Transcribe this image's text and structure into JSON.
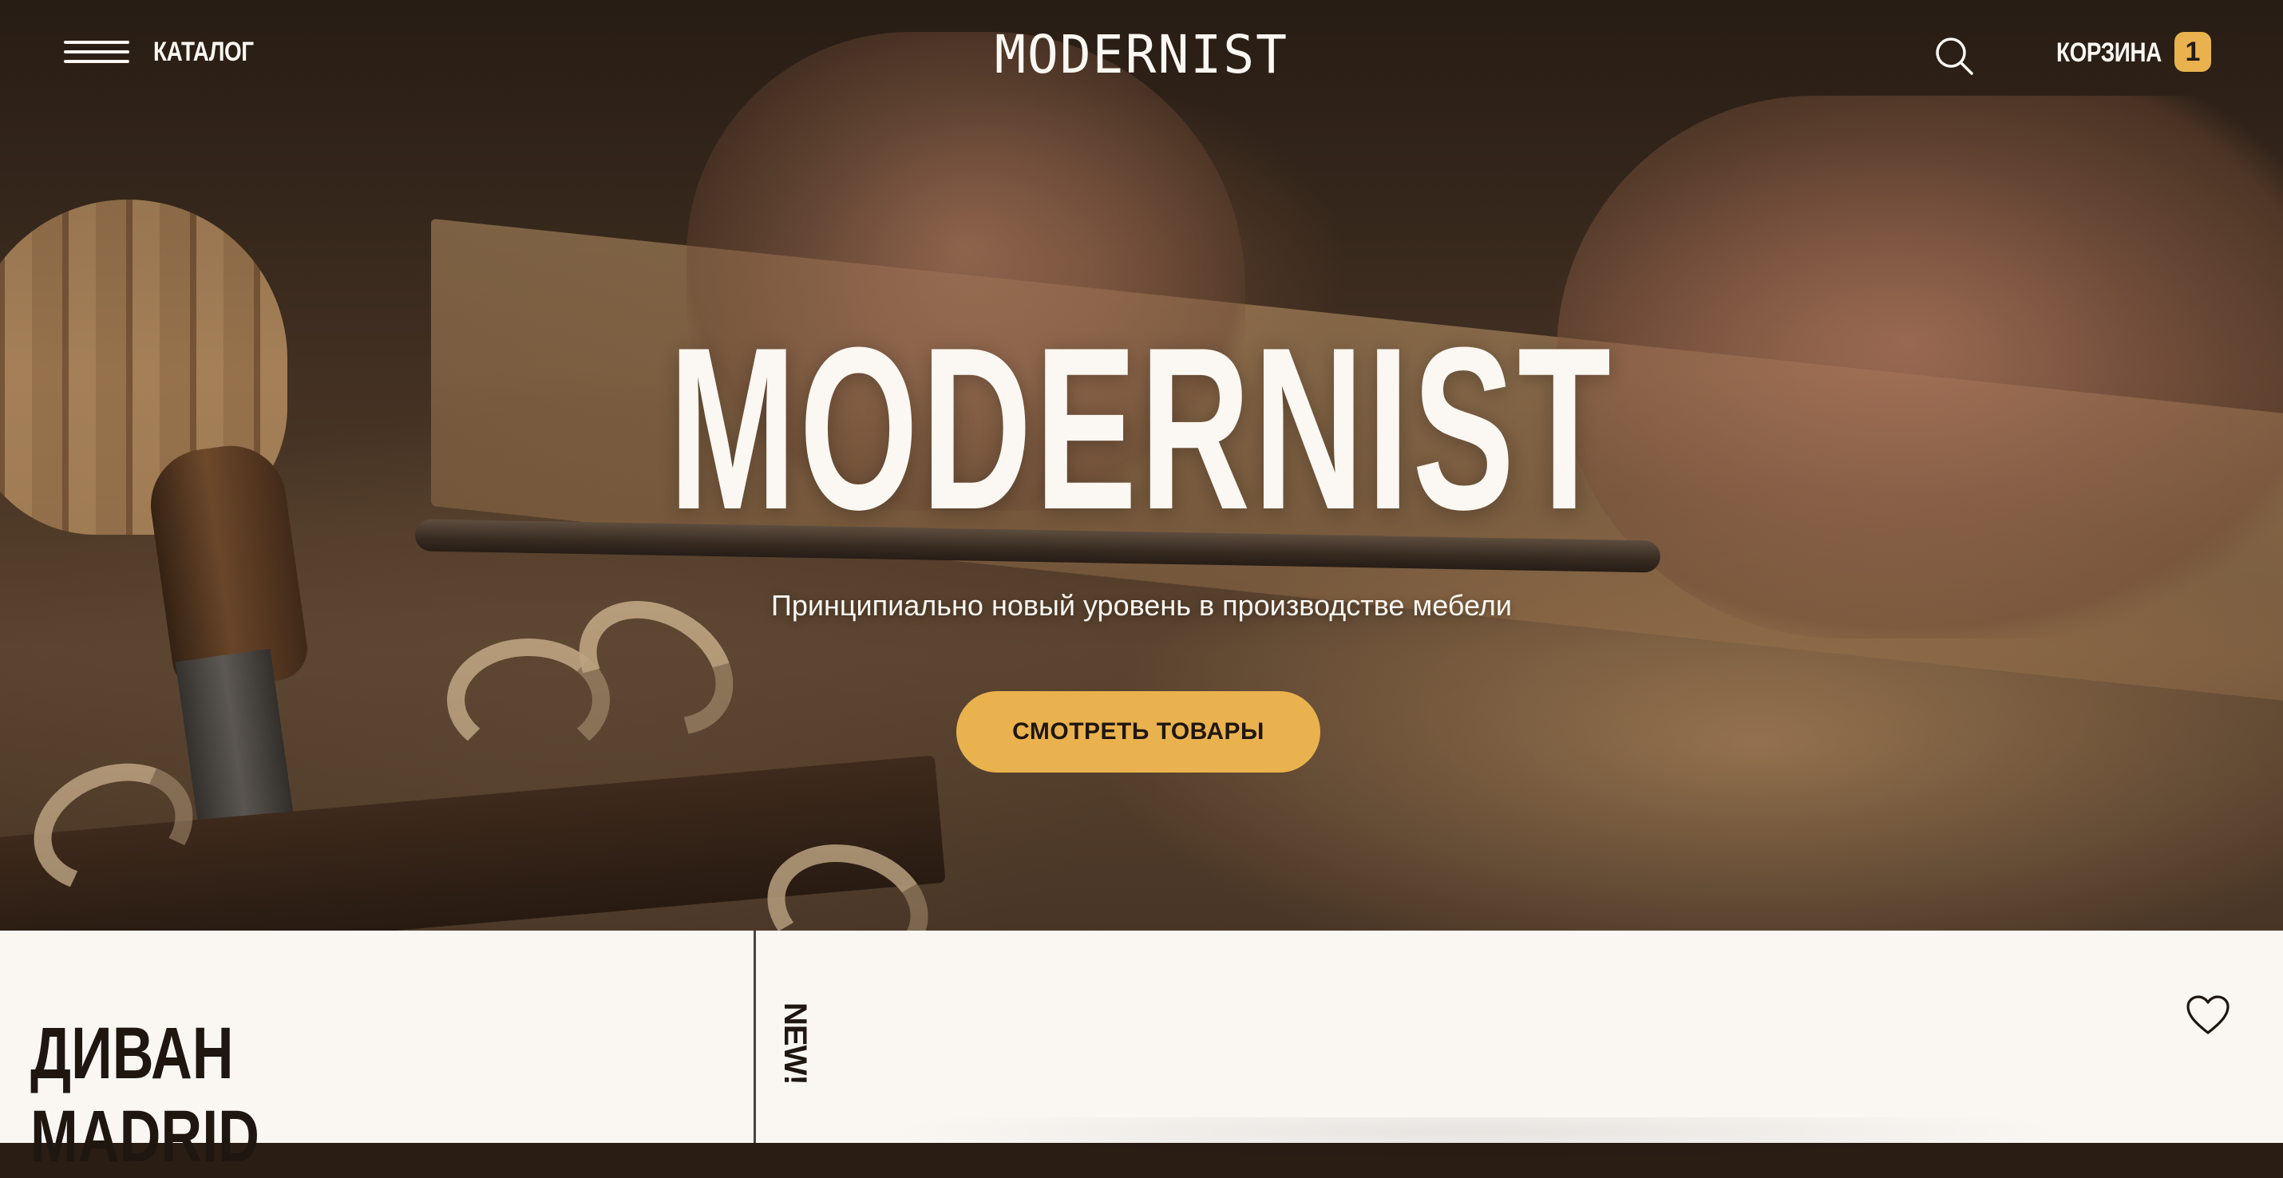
{
  "header": {
    "menu_label": "КАТАЛОГ",
    "brand": "MODERNIST",
    "cart_label": "КОРЗИНА",
    "cart_count": "1"
  },
  "hero": {
    "title": "MODERNIST",
    "subtitle": "Принципиально новый уровень в производстве мебели",
    "cta_label": "СМОТРЕТЬ ТОВАРЫ"
  },
  "product": {
    "name": "ДИВАН\nMADRID",
    "badge": "NEW!"
  },
  "icons": {
    "menu": "hamburger-icon",
    "search": "search-icon",
    "favorite": "heart-icon"
  },
  "colors": {
    "accent": "#e9b24e",
    "light": "#fbf7f2",
    "dark": "#1f1610",
    "panel": "#faf7f3"
  }
}
